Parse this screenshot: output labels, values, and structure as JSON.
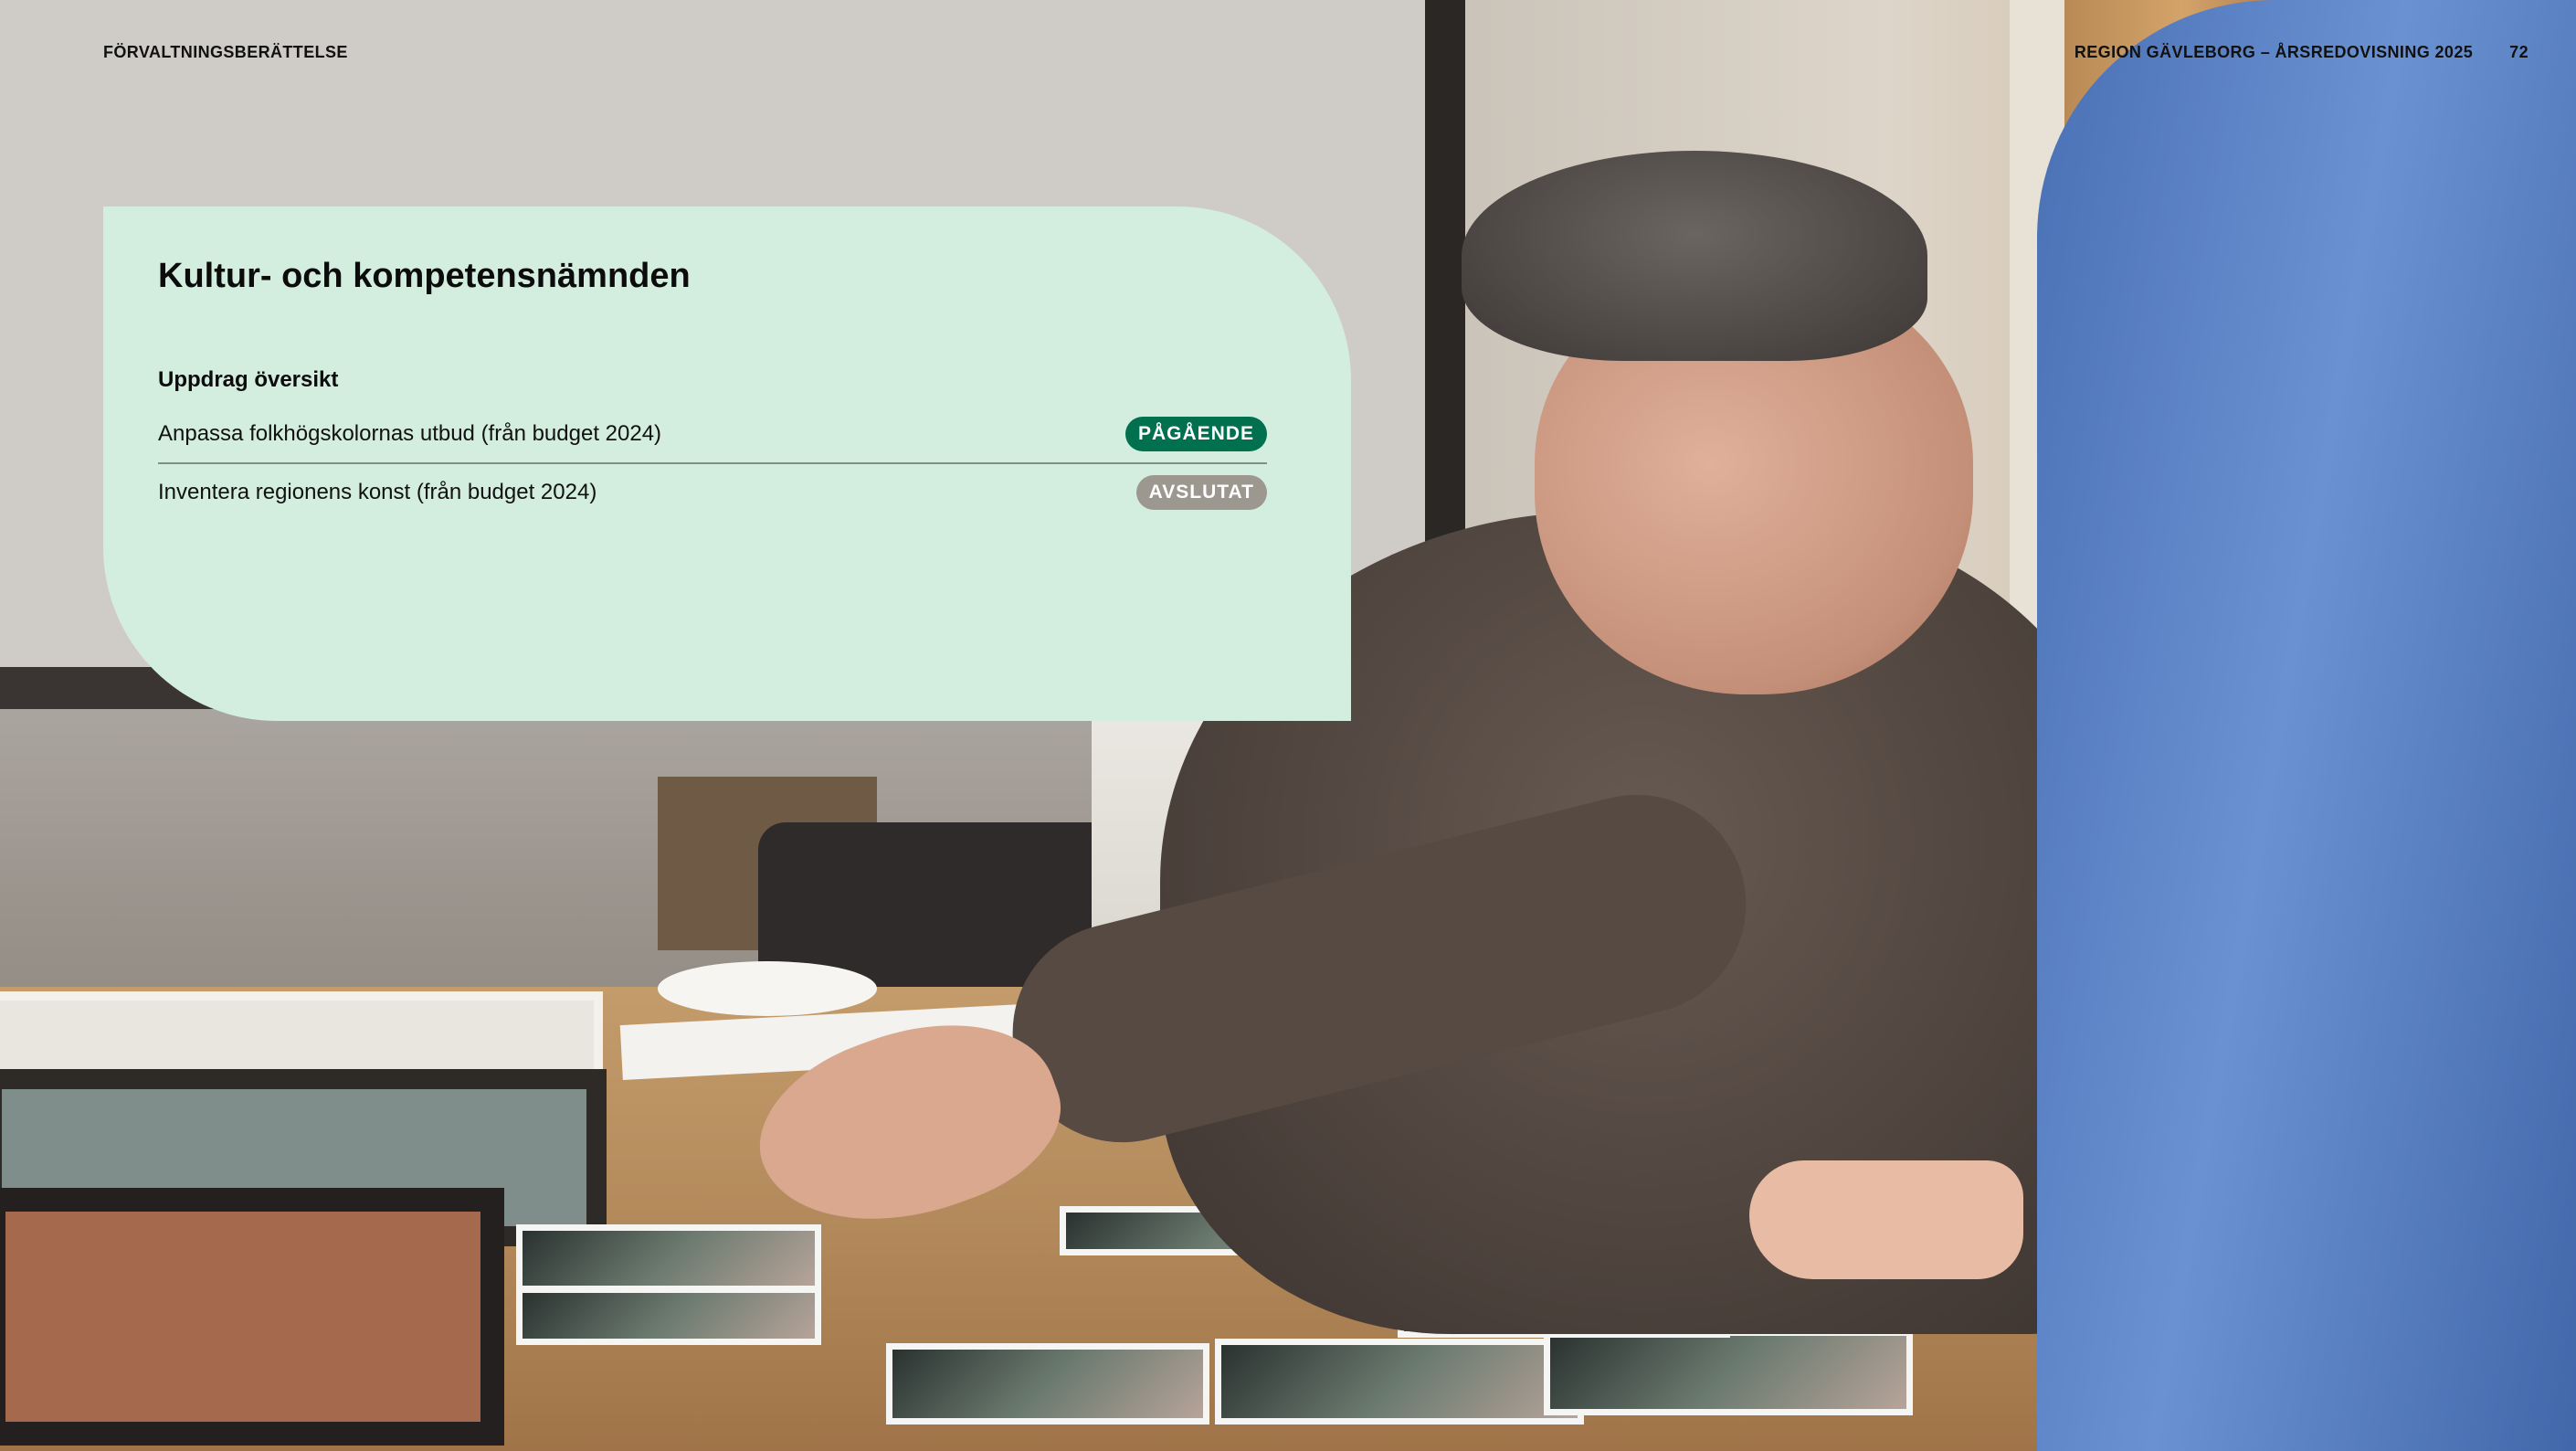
{
  "header": {
    "section": "FÖRVALTNINGSBERÄTTELSE",
    "report": "REGION GÄVLEBORG – ÅRSREDOVISNING 2025",
    "page_number": "72"
  },
  "card": {
    "title": "Kultur- och kompetensnämnden",
    "section_title": "Uppdrag översikt",
    "items": [
      {
        "label": "Anpassa folkhögskolornas utbud (från budget 2024)",
        "status": "PÅGÅENDE",
        "status_color": "#00704f"
      },
      {
        "label": "Inventera regionens konst (från budget 2024)",
        "status": "AVSLUTAT",
        "status_color": "#9c9890"
      }
    ],
    "background_color": "#d3eedf"
  }
}
